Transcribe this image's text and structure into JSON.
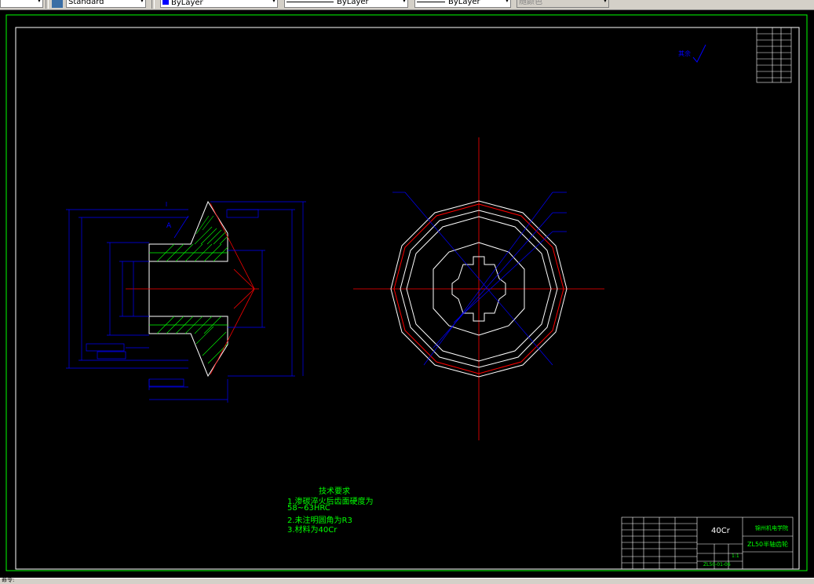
{
  "toolbar": {
    "text_style_value": "Standard",
    "color_value": "ByLayer",
    "linetype_value": "ByLayer",
    "lineweight_value": "ByLayer",
    "plotstyle_value": "随颜色"
  },
  "drawing": {
    "view_label": "A",
    "section_label": "A",
    "roughness_note": "其余",
    "tech_req": {
      "title": "技术要求",
      "lines": [
        "1.渗碳淬火后齿面硬度为",
        "58~63HRC",
        "2.未注明圆角为R3",
        "3.材料为40Cr"
      ]
    },
    "title_block": {
      "material": "40Cr",
      "part_name": "ZL50半轴齿轮",
      "school": "锦州机电学院",
      "scale": "1:1",
      "drawing_no": "ZL50-01-06"
    }
  },
  "status": {
    "coords_text": "命令:"
  },
  "colors": {
    "background": "#000000",
    "outline": "#ffffff",
    "dimension": "#0000ff",
    "centerline": "#ff0000",
    "frame": "#00ff00",
    "hatch": "#00ff00"
  }
}
